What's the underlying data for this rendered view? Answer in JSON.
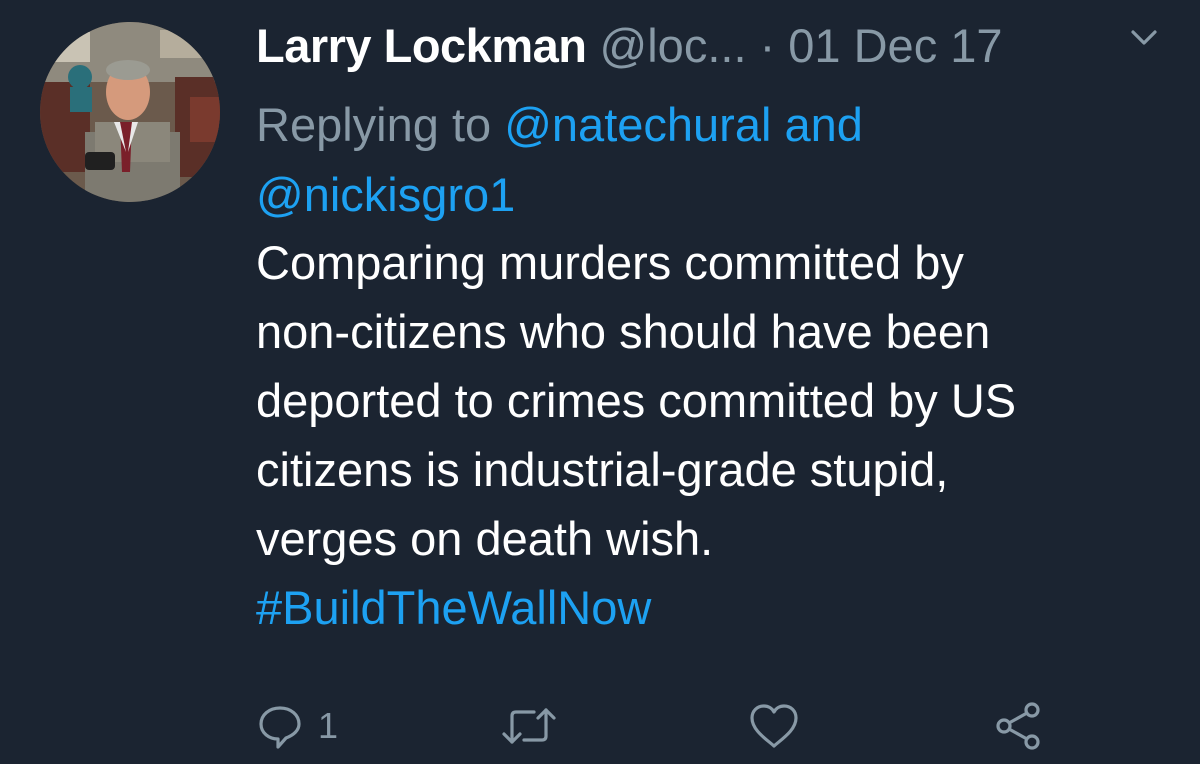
{
  "tweet": {
    "author_name": "Larry Lockman",
    "author_handle": "@loc...",
    "separator": "·",
    "date": "01 Dec 17",
    "reply_prefix": "Replying to",
    "reply_mention_1": "@natechural",
    "reply_conjunction": "and",
    "reply_mention_2": "@nickisgro1",
    "body_lines": [
      "Comparing murders committed by",
      "non-citizens who should have been",
      "deported to crimes committed by US",
      "citizens is industrial-grade stupid,",
      "verges on death wish."
    ],
    "hashtag": "#BuildTheWallNow"
  },
  "actions": {
    "reply_count": "1",
    "icons": [
      "reply-icon",
      "retweet-icon",
      "like-icon",
      "share-icon"
    ]
  },
  "colors": {
    "background": "#1b2431",
    "primary_text": "#ffffff",
    "secondary_text": "#8899a6",
    "link": "#1da1f2"
  }
}
